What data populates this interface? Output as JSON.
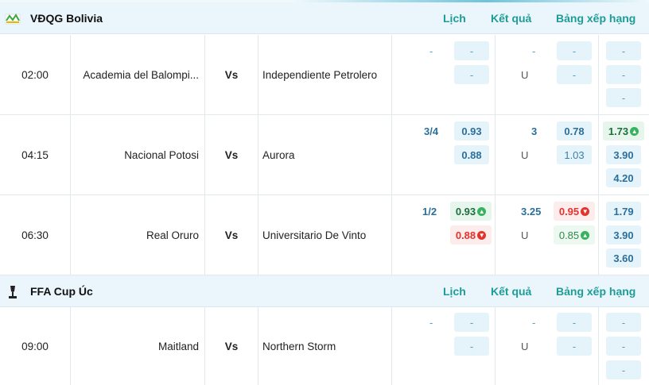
{
  "leagues": [
    {
      "name": "VĐQG Bolivia",
      "logo": "bolivia-league-logo",
      "links": {
        "schedule": "Lịch",
        "results": "Kết quả",
        "standings": "Bảng xếp hạng"
      },
      "matches": [
        {
          "time": "02:00",
          "home": "Academia del Balompi...",
          "vs": "Vs",
          "away": "Independiente Petrolero",
          "ah_line": "-",
          "ah_home": "-",
          "ah_away": "-",
          "ou_line": "-",
          "ou_over": "-",
          "ou_under_label": "U",
          "ou_under": "-",
          "x12_home": "-",
          "x12_draw": "-",
          "x12_away": "-"
        },
        {
          "time": "04:15",
          "home": "Nacional Potosi",
          "vs": "Vs",
          "away": "Aurora",
          "ah_line": "3/4",
          "ah_home": "0.93",
          "ah_away": "0.88",
          "ou_line": "3",
          "ou_over": "0.78",
          "ou_under_label": "U",
          "ou_under": "1.03",
          "x12_home": "1.73",
          "x12_draw": "3.90",
          "x12_away": "4.20"
        },
        {
          "time": "06:30",
          "home": "Real Oruro",
          "vs": "Vs",
          "away": "Universitario De Vinto",
          "ah_line": "1/2",
          "ah_home": "0.93",
          "ah_away": "0.88",
          "ou_line": "3.25",
          "ou_over": "0.95",
          "ou_under_label": "U",
          "ou_under": "0.85",
          "x12_home": "1.79",
          "x12_draw": "3.90",
          "x12_away": "3.60"
        }
      ]
    },
    {
      "name": "FFA Cup Úc",
      "logo": "ffa-cup-logo",
      "links": {
        "schedule": "Lịch",
        "results": "Kết quả",
        "standings": "Bảng xếp hạng"
      },
      "matches": [
        {
          "time": "09:00",
          "home": "Maitland",
          "vs": "Vs",
          "away": "Northern Storm",
          "ah_line": "-",
          "ah_home": "-",
          "ah_away": "-",
          "ou_line": "-",
          "ou_over": "-",
          "ou_under_label": "U",
          "ou_under": "-",
          "x12_home": "-",
          "x12_draw": "-",
          "x12_away": "-"
        }
      ]
    }
  ],
  "colors": {
    "accent": "#1e9c97",
    "odds_text": "#2c6f9b",
    "odds_bg": "#e5f3fa",
    "up": "#37b25f",
    "down": "#e2332d",
    "header_bg": "#eaf6fb"
  }
}
